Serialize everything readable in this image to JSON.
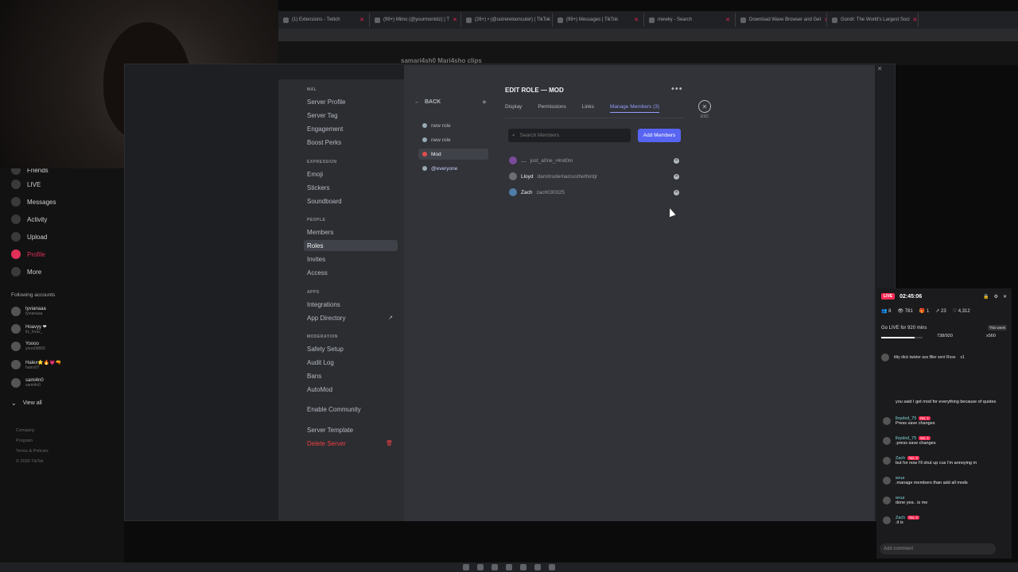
{
  "browser": {
    "tabs": [
      {
        "label": "(1) Extensions - Twitch"
      },
      {
        "label": "(99+) Mimo (@yourmonlolz) | T"
      },
      {
        "label": "(26+) • (@ustrerelooncuter) | TikTok"
      },
      {
        "label": "(99+) Messages | TikTok"
      },
      {
        "label": "mewky - Search"
      },
      {
        "label": "Download Wave Browser and Get"
      },
      {
        "label": "Gondr: The World's Largest Soci"
      }
    ]
  },
  "tiktok": {
    "page_header": "samari4sh0   Mari4sho clips",
    "nav": [
      {
        "label": "Friends"
      },
      {
        "label": "LIVE"
      },
      {
        "label": "Messages"
      },
      {
        "label": "Activity"
      },
      {
        "label": "Upload"
      },
      {
        "label": "Profile"
      },
      {
        "label": "More"
      }
    ],
    "following_heading": "Following accounts",
    "following": [
      {
        "name": "tyvianaaa",
        "handle": "tyvianaaa"
      },
      {
        "name": "Hoavyy ❤",
        "handle": "itz_hoav_"
      },
      {
        "name": "Yoooo",
        "handle": "yooo09890"
      },
      {
        "name": "Halex⭐🔥💗🔫",
        "handle": "halex07"
      },
      {
        "name": "sami4n0",
        "handle": "sami4n0"
      }
    ],
    "view_all": "View all",
    "footer": [
      "Company",
      "Program",
      "Terms & Policies",
      "© 2025 TikTok"
    ]
  },
  "settings": {
    "server_cat": "Mál",
    "items_server": [
      "Server Profile",
      "Server Tag",
      "Engagement",
      "Boost Perks"
    ],
    "cat_expression": "Expression",
    "items_expression": [
      "Emoji",
      "Stickers",
      "Soundboard"
    ],
    "cat_people": "People",
    "items_people": [
      "Members",
      "Roles",
      "Invites",
      "Access"
    ],
    "cat_apps": "Apps",
    "items_apps": [
      "Integrations",
      "App Directory"
    ],
    "cat_moderation": "Moderation",
    "items_moderation": [
      "Safety Setup",
      "Audit Log",
      "Bans",
      "AutoMod"
    ],
    "enable_community": "Enable Community",
    "server_template": "Server Template",
    "delete_server": "Delete Server"
  },
  "roles": {
    "back_label": "BACK",
    "add_icon": "+",
    "list": [
      "new role",
      "new role",
      "Mod",
      "@everyone"
    ]
  },
  "edit_role": {
    "title": "EDIT ROLE — MOD",
    "more": "•••",
    "tabs": [
      "Display",
      "Permissions",
      "Links",
      "Manage Members (3)"
    ],
    "esc_label": "ESC",
    "search_placeholder": "Search Members",
    "add_members_label": "Add Members",
    "members": [
      {
        "name": "…",
        "username": "just_a0ne_r4nd0m"
      },
      {
        "name": "Lloyd",
        "username": "damitrudemarcusthethirdjr"
      },
      {
        "name": "Zach",
        "username": "zach030325"
      }
    ]
  },
  "live": {
    "badge": "LIVE",
    "time": "02:45:06",
    "stats": [
      "8",
      "781",
      "1",
      "23",
      "4,312"
    ],
    "goal_title": "Go LIVE for 920 mins",
    "goal_progress": "738/920",
    "goal_fraction": 0.8,
    "week_badge": "This week",
    "coins": "x560",
    "pinned": "titty dick twister ass filler  sent Rose",
    "pinned_count": "x1",
    "chat": [
      {
        "who": "",
        "badge": "",
        "msg": "you said I get mod for everything because of quotes"
      },
      {
        "who": "lloydxd_75",
        "badge": "No. 1",
        "msg": "Press save changes"
      },
      {
        "who": "lloydxd_75",
        "badge": "No. 1",
        "msg": ".press save changes"
      },
      {
        "who": "Zach",
        "badge": "No. 2",
        "msg": "but for now I'll shut up cus I'm annoying m"
      },
      {
        "who": "ᴡᴀʟᴇ",
        "badge": "",
        "msg": ".manage members than add all mods"
      },
      {
        "who": "ᴡᴀʟᴇ",
        "badge": "",
        "msg": "done yea . is me"
      },
      {
        "who": "Zach",
        "badge": "No. 2",
        "msg": ".it is"
      }
    ],
    "comment_placeholder": "Add comment"
  },
  "colors": {
    "accent": "#5865f2",
    "danger": "#f23f43",
    "live": "#fe2c55",
    "mod_role": "#e24d4d"
  }
}
